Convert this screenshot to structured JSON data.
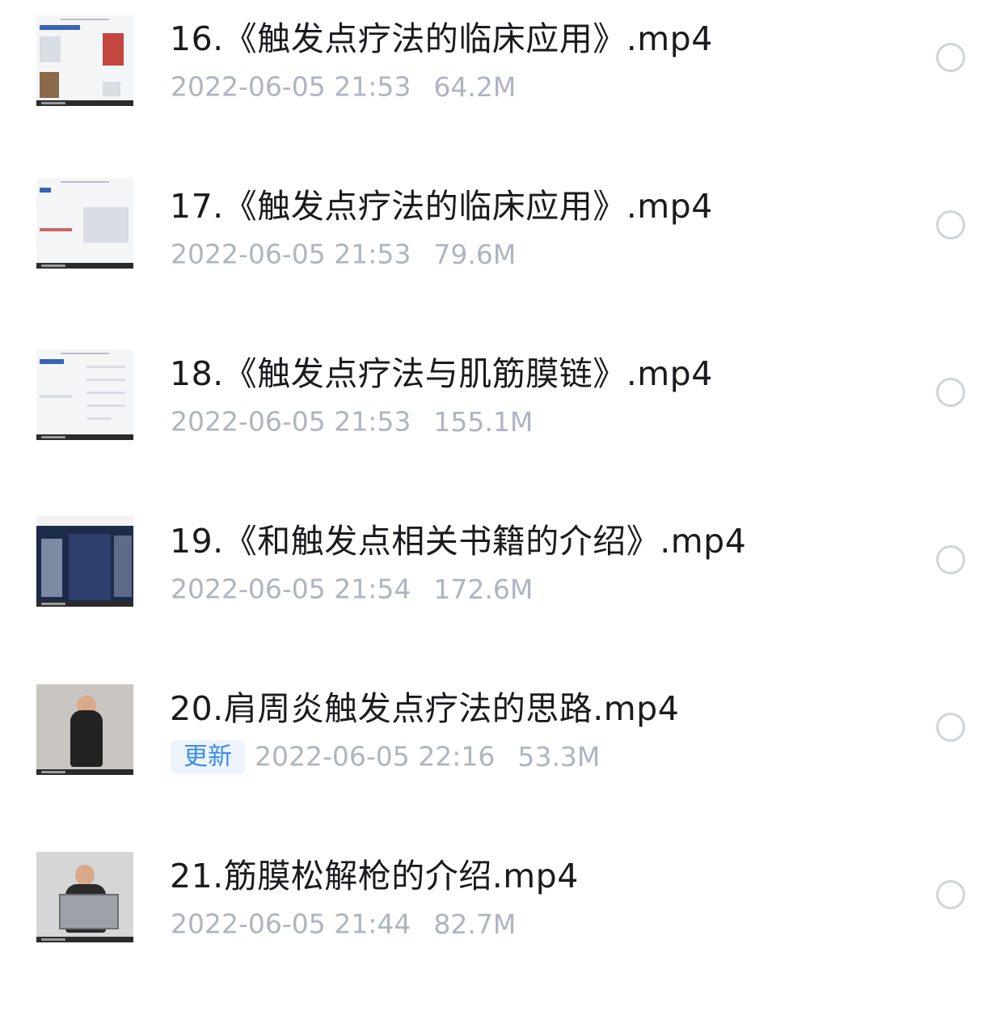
{
  "files": [
    {
      "thumbnail": "slide-thumbnail",
      "title": "16.《触发点疗法的临床应用》.mp4",
      "datetime": "2022-06-05 21:53",
      "size": "64.2M"
    },
    {
      "thumbnail": "slide-thumbnail",
      "title": "17.《触发点疗法的临床应用》.mp4",
      "datetime": "2022-06-05 21:53",
      "size": "79.6M"
    },
    {
      "thumbnail": "slide-thumbnail",
      "title": "18.《触发点疗法与肌筋膜链》.mp4",
      "datetime": "2022-06-05 21:53",
      "size": "155.1M"
    },
    {
      "thumbnail": "book-cover-thumbnail",
      "title": "19.《和触发点相关书籍的介绍》.mp4",
      "datetime": "2022-06-05 21:54",
      "size": "172.6M"
    },
    {
      "thumbnail": "presenter-video-thumbnail",
      "title": "20.肩周炎触发点疗法的思路.mp4",
      "badge": "更新",
      "datetime": "2022-06-05 22:16",
      "size": "53.3M"
    },
    {
      "thumbnail": "presenter-video-thumbnail",
      "title": "21.筋膜松解枪的介绍.mp4",
      "datetime": "2022-06-05 21:44",
      "size": "82.7M"
    }
  ],
  "colors": {
    "title": "#1b1b1f",
    "meta": "#aeb4c2",
    "badge_text": "#3b8bea",
    "badge_bg": "#eef4fc",
    "radio_border": "#cfd3da"
  },
  "icons": {
    "select": "radio-circle-icon"
  }
}
